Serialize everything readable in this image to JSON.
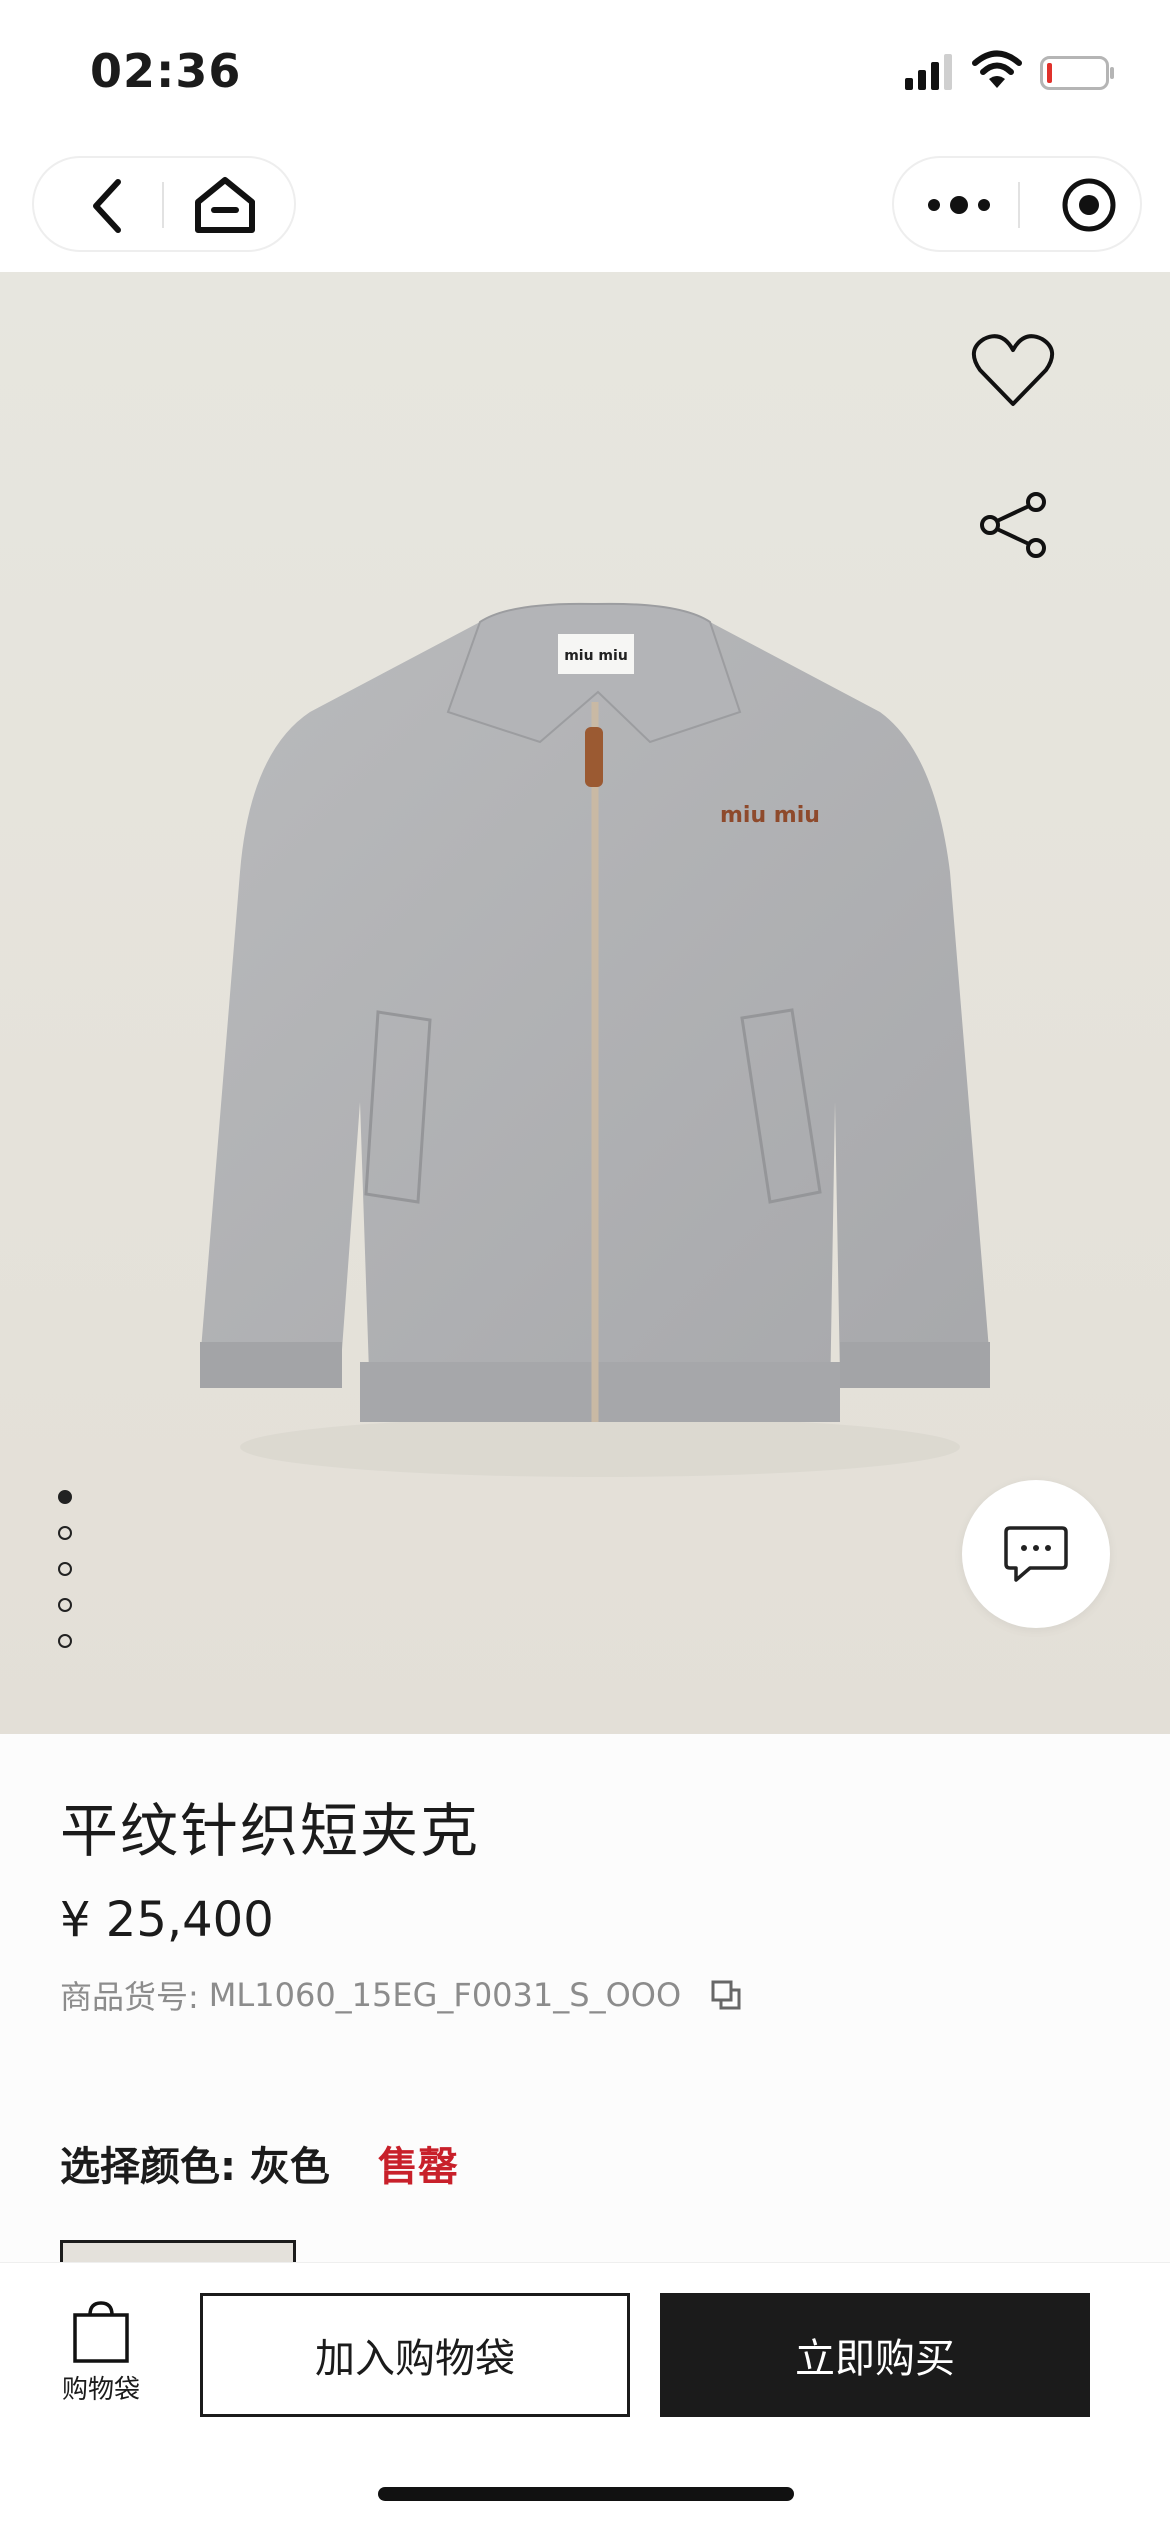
{
  "status_bar": {
    "time": "02:36"
  },
  "nav": {
    "back_icon": "chevron-left-icon",
    "home_icon": "home-icon",
    "more_icon": "more-dots-icon",
    "close_icon": "target-icon"
  },
  "hero": {
    "image_alt": "miu miu",
    "favorite_icon": "heart-icon",
    "share_icon": "share-icon",
    "chat_icon": "chat-bubble-icon",
    "pager": {
      "count": 5,
      "active_index": 0
    }
  },
  "product": {
    "title": "平纹针织短夹克",
    "price": "¥ 25,400",
    "sku_label": "商品货号:",
    "sku": "ML1060_15EG_F0031_S_OOO",
    "color_label": "选择颜色: 灰色",
    "stock_status": "售罄"
  },
  "bottom_bar": {
    "bag_label": "购物袋",
    "add_to_cart": "加入购物袋",
    "buy_now": "立即购买"
  },
  "colors": {
    "accent_red": "#c8202a",
    "dark": "#1b1b1b",
    "hero_bg": "#e6e3dc"
  }
}
